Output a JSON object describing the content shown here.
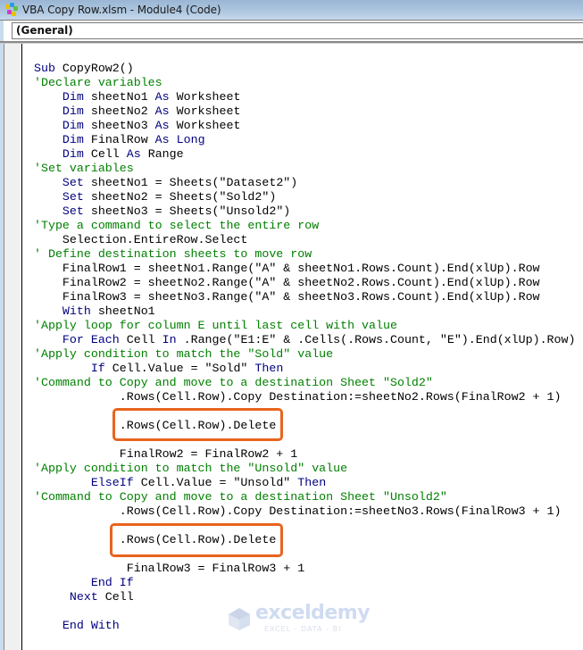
{
  "window": {
    "title": "VBA Copy Row.xlsm - Module4 (Code)",
    "icon": "vba-project-icon"
  },
  "toolbar": {
    "object_dropdown_value": "(General)"
  },
  "colors": {
    "keyword": "#00007f",
    "comment": "#008000",
    "text": "#000000",
    "highlight_border": "#e8641e",
    "titlebar": "#b3cbe3"
  },
  "code_lines": [
    [
      [
        "kw",
        "Sub"
      ],
      [
        "tx",
        " CopyRow2()"
      ]
    ],
    [
      [
        "cm",
        "'Declare variables"
      ]
    ],
    [
      [
        "tx",
        "    "
      ],
      [
        "kw",
        "Dim"
      ],
      [
        "tx",
        " sheetNo1 "
      ],
      [
        "kw",
        "As"
      ],
      [
        "tx",
        " Worksheet"
      ]
    ],
    [
      [
        "tx",
        "    "
      ],
      [
        "kw",
        "Dim"
      ],
      [
        "tx",
        " sheetNo2 "
      ],
      [
        "kw",
        "As"
      ],
      [
        "tx",
        " Worksheet"
      ]
    ],
    [
      [
        "tx",
        "    "
      ],
      [
        "kw",
        "Dim"
      ],
      [
        "tx",
        " sheetNo3 "
      ],
      [
        "kw",
        "As"
      ],
      [
        "tx",
        " Worksheet"
      ]
    ],
    [
      [
        "tx",
        "    "
      ],
      [
        "kw",
        "Dim"
      ],
      [
        "tx",
        " FinalRow "
      ],
      [
        "kw",
        "As"
      ],
      [
        "tx",
        " "
      ],
      [
        "kw",
        "Long"
      ]
    ],
    [
      [
        "tx",
        "    "
      ],
      [
        "kw",
        "Dim"
      ],
      [
        "tx",
        " Cell "
      ],
      [
        "kw",
        "As"
      ],
      [
        "tx",
        " Range"
      ]
    ],
    [
      [
        "cm",
        "'Set variables"
      ]
    ],
    [
      [
        "tx",
        "    "
      ],
      [
        "kw",
        "Set"
      ],
      [
        "tx",
        " sheetNo1 = Sheets(\"Dataset2\")"
      ]
    ],
    [
      [
        "tx",
        "    "
      ],
      [
        "kw",
        "Set"
      ],
      [
        "tx",
        " sheetNo2 = Sheets(\"Sold2\")"
      ]
    ],
    [
      [
        "tx",
        "    "
      ],
      [
        "kw",
        "Set"
      ],
      [
        "tx",
        " sheetNo3 = Sheets(\"Unsold2\")"
      ]
    ],
    [
      [
        "cm",
        "'Type a command to select the entire row"
      ]
    ],
    [
      [
        "tx",
        "    Selection.EntireRow.Select"
      ]
    ],
    [
      [
        "cm",
        "' Define destination sheets to move row"
      ]
    ],
    [
      [
        "tx",
        "    FinalRow1 = sheetNo1.Range(\"A\" & sheetNo1.Rows.Count).End(xlUp).Row"
      ]
    ],
    [
      [
        "tx",
        "    FinalRow2 = sheetNo2.Range(\"A\" & sheetNo2.Rows.Count).End(xlUp).Row"
      ]
    ],
    [
      [
        "tx",
        "    FinalRow3 = sheetNo3.Range(\"A\" & sheetNo3.Rows.Count).End(xlUp).Row"
      ]
    ],
    [
      [
        "tx",
        "    "
      ],
      [
        "kw",
        "With"
      ],
      [
        "tx",
        " sheetNo1"
      ]
    ],
    [
      [
        "cm",
        "'Apply loop for column E until last cell with value"
      ]
    ],
    [
      [
        "tx",
        "    "
      ],
      [
        "kw",
        "For Each"
      ],
      [
        "tx",
        " Cell "
      ],
      [
        "kw",
        "In"
      ],
      [
        "tx",
        " .Range(\"E1:E\" & .Cells(.Rows.Count, \"E\").End(xlUp).Row)"
      ]
    ],
    [
      [
        "cm",
        "'Apply condition to match the \"Sold\" value"
      ]
    ],
    [
      [
        "tx",
        "        "
      ],
      [
        "kw",
        "If"
      ],
      [
        "tx",
        " Cell.Value = \"Sold\" "
      ],
      [
        "kw",
        "Then"
      ]
    ],
    [
      [
        "cm",
        "'Command to Copy and move to a destination Sheet \"Sold2\""
      ]
    ],
    [
      [
        "tx",
        "            .Rows(Cell.Row).Copy Destination:=sheetNo2.Rows(FinalRow2 + 1)"
      ]
    ],
    [
      [
        "tx",
        ""
      ]
    ],
    [
      [
        "tx",
        "            .Rows(Cell.Row).Delete"
      ]
    ],
    [
      [
        "tx",
        ""
      ]
    ],
    [
      [
        "tx",
        "            FinalRow2 = FinalRow2 + 1"
      ]
    ],
    [
      [
        "cm",
        "'Apply condition to match the \"Unsold\" value"
      ]
    ],
    [
      [
        "tx",
        "        "
      ],
      [
        "kw",
        "ElseIf"
      ],
      [
        "tx",
        " Cell.Value = \"Unsold\" "
      ],
      [
        "kw",
        "Then"
      ]
    ],
    [
      [
        "cm",
        "'Command to Copy and move to a destination Sheet \"Unsold2\""
      ]
    ],
    [
      [
        "tx",
        "            .Rows(Cell.Row).Copy Destination:=sheetNo3.Rows(FinalRow3 + 1)"
      ]
    ],
    [
      [
        "tx",
        ""
      ]
    ],
    [
      [
        "tx",
        "            .Rows(Cell.Row).Delete"
      ]
    ],
    [
      [
        "tx",
        ""
      ]
    ],
    [
      [
        "tx",
        "             FinalRow3 = FinalRow3 + 1"
      ]
    ],
    [
      [
        "tx",
        "        "
      ],
      [
        "kw",
        "End If"
      ]
    ],
    [
      [
        "tx",
        "     "
      ],
      [
        "kw",
        "Next"
      ],
      [
        "tx",
        " Cell"
      ]
    ],
    [
      [
        "tx",
        ""
      ]
    ],
    [
      [
        "tx",
        "    "
      ],
      [
        "kw",
        "End With"
      ]
    ]
  ],
  "highlighted_lines": [
    25,
    33
  ],
  "watermark": {
    "brand": "exceldemy",
    "tagline": "EXCEL - DATA - BI"
  }
}
